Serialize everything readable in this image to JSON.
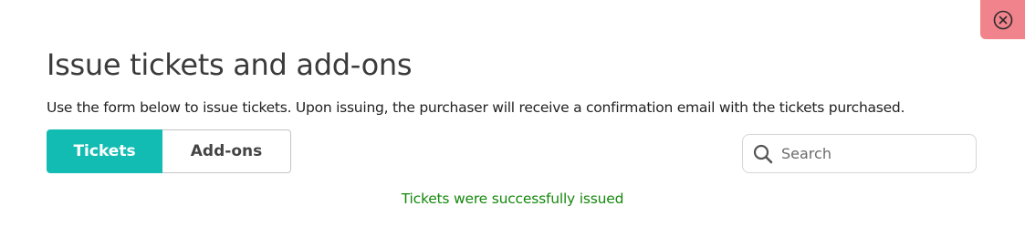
{
  "dialog": {
    "title": "Issue tickets and add-ons",
    "description": "Use the form below to issue tickets. Upon issuing, the purchaser will receive a confirmation email with the tickets purchased.",
    "close_icon": "close-circle-icon",
    "close_color": "#f1838c"
  },
  "tabs": [
    {
      "label": "Tickets",
      "active": true
    },
    {
      "label": "Add-ons",
      "active": false
    }
  ],
  "search": {
    "placeholder": "Search",
    "value": "",
    "icon": "search-icon"
  },
  "status": {
    "message": "Tickets were successfully issued",
    "color": "#15880d"
  },
  "colors": {
    "accent": "#12bcb3"
  }
}
